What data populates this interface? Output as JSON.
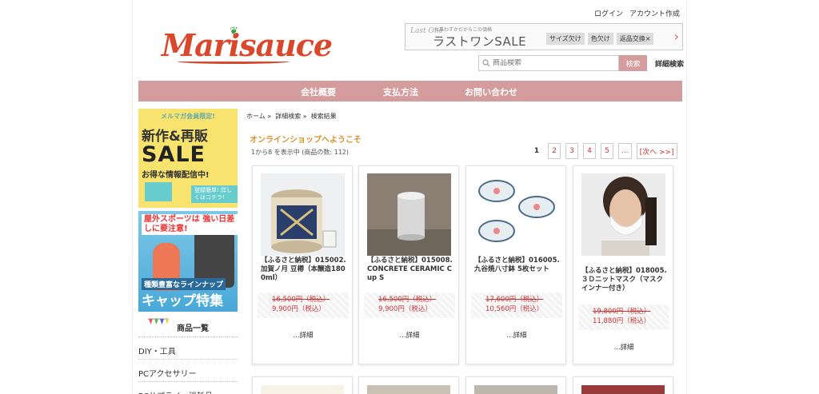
{
  "header": {
    "login": "ログイン",
    "signup": "アカウント作成",
    "logo": "Marisauce",
    "sale_banner": {
      "script": "Last One",
      "sub": "仕事わずかだからこの価格",
      "main": "ラストワンSALE",
      "tags": [
        "サイズ欠け",
        "色欠け",
        "返品交換×"
      ]
    },
    "search_placeholder": "商品検索",
    "search_button": "検索",
    "advanced_search": "詳細検索"
  },
  "nav": [
    "会社概要",
    "支払方法",
    "お問い合わせ"
  ],
  "sidebar": {
    "banner1": {
      "top": "メルマガ会員限定!",
      "line1": "新作&再販",
      "line2": "SALE",
      "line3": "お得な情報配信中!",
      "cta": "登録簡単! 詳しくはコチラ!"
    },
    "banner2": {
      "line1": "屋外スポーツは 強い日差しに要注意!",
      "line2": "種類豊富なラインナップ",
      "line3": "キャップ特集"
    },
    "category_title": "商品一覧",
    "categories": [
      "DIY・工具",
      "PCアクセサリー",
      "PCサプライ・消耗品"
    ]
  },
  "main": {
    "breadcrumb": [
      "ホーム »",
      "詳細検索 »",
      "検索結果"
    ],
    "welcome": "オンラインショップへようこそ",
    "count": "1から8 を表示中 (商品の数: 112)",
    "pager": [
      "1",
      "2",
      "3",
      "4",
      "5",
      "...",
      "[次へ >>]"
    ],
    "products": [
      {
        "name": "【ふるさと納税】015002. 加賀ノ月 豆樽（本醸造1800ml）",
        "old_price": "16,500円（税込）",
        "price": "9,900円（税込）",
        "detail": "...詳細"
      },
      {
        "name": "【ふるさと納税】015008. CONCRETE CERAMIC Cup S",
        "old_price": "16,500円（税込）",
        "price": "9,900円（税込）",
        "detail": "...詳細"
      },
      {
        "name": "【ふるさと納税】016005. 九谷焼八寸鉢 5枚セット",
        "old_price": "17,600円（税込）",
        "price": "10,560円（税込）",
        "detail": "...詳細"
      },
      {
        "name": "【ふるさと納税】018005. ３Ｄニットマスク（マスクインナー付き）",
        "old_price": "19,800円（税込）",
        "price": "11,880円（税込）",
        "detail": "...詳細"
      }
    ]
  },
  "colors": {
    "accent": "#d49c9c",
    "logo": "#d9482b",
    "welcome": "#d9922b",
    "price": "#cc3333"
  }
}
